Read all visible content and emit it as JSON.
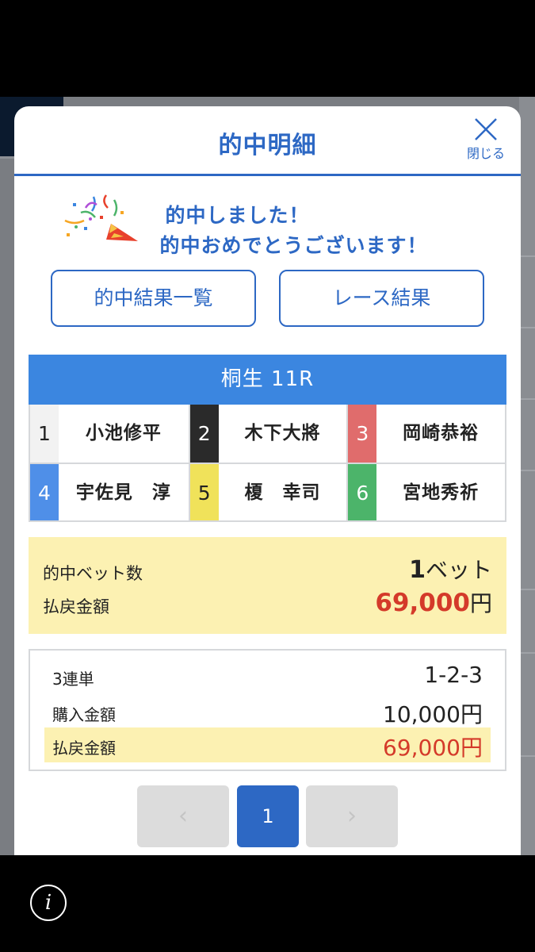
{
  "modal": {
    "title": "的中明細",
    "close_label": "閉じる"
  },
  "congrats": {
    "line1": "的中しました！",
    "line2": "的中おめでとうございます！"
  },
  "buttons": {
    "hit_list": "的中結果一覧",
    "race_results": "レース結果"
  },
  "race": {
    "name": "桐生 11R",
    "racers": [
      {
        "num": "1",
        "name": "小池修平"
      },
      {
        "num": "2",
        "name": "木下大將"
      },
      {
        "num": "3",
        "name": "岡崎恭裕"
      },
      {
        "num": "4",
        "name": "宇佐見　淳"
      },
      {
        "num": "5",
        "name": "榎　幸司"
      },
      {
        "num": "6",
        "name": "宮地秀祈"
      }
    ]
  },
  "summary": {
    "bets_label": "的中ベット数",
    "bets_count": "1",
    "bets_unit": "ベット",
    "payout_label": "払戻金額",
    "payout_amount": "69,000",
    "payout_unit": "円"
  },
  "detail": {
    "bet_type": "3連単",
    "combination": "1-2-3",
    "purchase_label": "購入金額",
    "purchase_amount": "10,000円",
    "payout_label": "払戻金額",
    "payout_amount": "69,000円"
  },
  "pager": {
    "prev": "‹",
    "current": "1",
    "next": "›"
  },
  "footer": {
    "info_glyph": "i"
  },
  "colors": {
    "accent": "#2d68c4",
    "race_header": "#3b86e0",
    "highlight": "#fcf1b2",
    "payout_red": "#d43a2a"
  }
}
